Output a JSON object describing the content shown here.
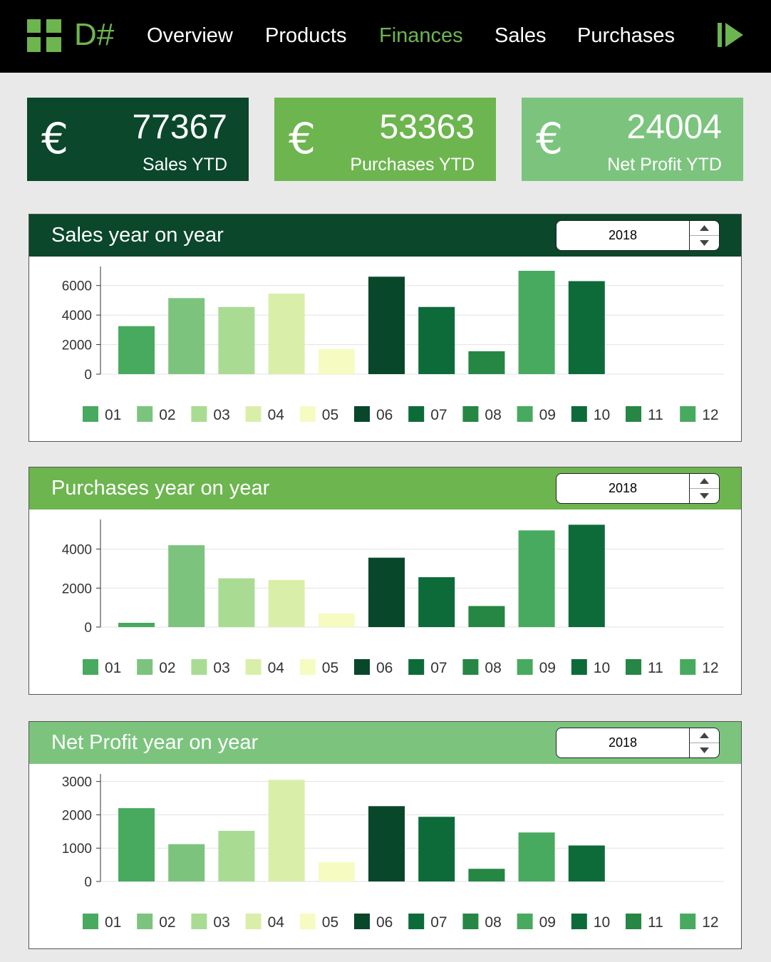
{
  "app": {
    "logo_text": "D#",
    "nav": [
      "Overview",
      "Products",
      "Finances",
      "Sales",
      "Purchases"
    ],
    "active_nav": "Finances"
  },
  "kpis": [
    {
      "icon": "euro-icon",
      "symbol": "€",
      "value": "77367",
      "label": "Sales YTD",
      "color": "#0a472b"
    },
    {
      "icon": "euro-icon",
      "symbol": "€",
      "value": "53363",
      "label": "Purchases YTD",
      "color": "#6db54f"
    },
    {
      "icon": "euro-icon",
      "symbol": "€",
      "value": "24004",
      "label": "Net Profit YTD",
      "color": "#7cc47e"
    }
  ],
  "colors": {
    "accent": "#6db54f",
    "months": [
      "#48aa5f",
      "#7cc47e",
      "#a9dc92",
      "#d9efa9",
      "#f6fbc2",
      "#09472b",
      "#0d6b3a",
      "#258743",
      "#48aa5f",
      "#0d6b3a",
      "#258743",
      "#48aa5f"
    ]
  },
  "panels": [
    {
      "title": "Sales year on year",
      "header_color": "#0a472b",
      "year": "2018",
      "chart_data": {
        "type": "bar",
        "categories": [
          "01",
          "02",
          "03",
          "04",
          "05",
          "06",
          "07",
          "08",
          "09",
          "10",
          "11",
          "12"
        ],
        "values": [
          3250,
          5150,
          4550,
          5450,
          1700,
          6600,
          4550,
          1550,
          7000,
          6300,
          null,
          null
        ],
        "yticks": [
          0,
          2000,
          4000,
          6000
        ],
        "ylim": [
          0,
          7000
        ],
        "grid": true,
        "legend": "bottom"
      }
    },
    {
      "title": "Purchases year on year",
      "header_color": "#6db54f",
      "year": "2018",
      "chart_data": {
        "type": "bar",
        "categories": [
          "01",
          "02",
          "03",
          "04",
          "05",
          "06",
          "07",
          "08",
          "09",
          "10",
          "11",
          "12"
        ],
        "values": [
          220,
          4200,
          2500,
          2420,
          700,
          3560,
          2560,
          1080,
          4960,
          5250,
          null,
          null
        ],
        "yticks": [
          0,
          2000,
          4000
        ],
        "ylim": [
          0,
          5300
        ],
        "grid": true,
        "legend": "bottom"
      }
    },
    {
      "title": "Net Profit year on year",
      "header_color": "#7cc47e",
      "year": "2018",
      "chart_data": {
        "type": "bar",
        "categories": [
          "01",
          "02",
          "03",
          "04",
          "05",
          "06",
          "07",
          "08",
          "09",
          "10",
          "11",
          "12"
        ],
        "values": [
          2200,
          1120,
          1520,
          3050,
          580,
          2260,
          1940,
          380,
          1470,
          1080,
          null,
          null
        ],
        "yticks": [
          0,
          1000,
          2000,
          3000
        ],
        "ylim": [
          0,
          3100
        ],
        "grid": true,
        "legend": "bottom"
      }
    }
  ]
}
